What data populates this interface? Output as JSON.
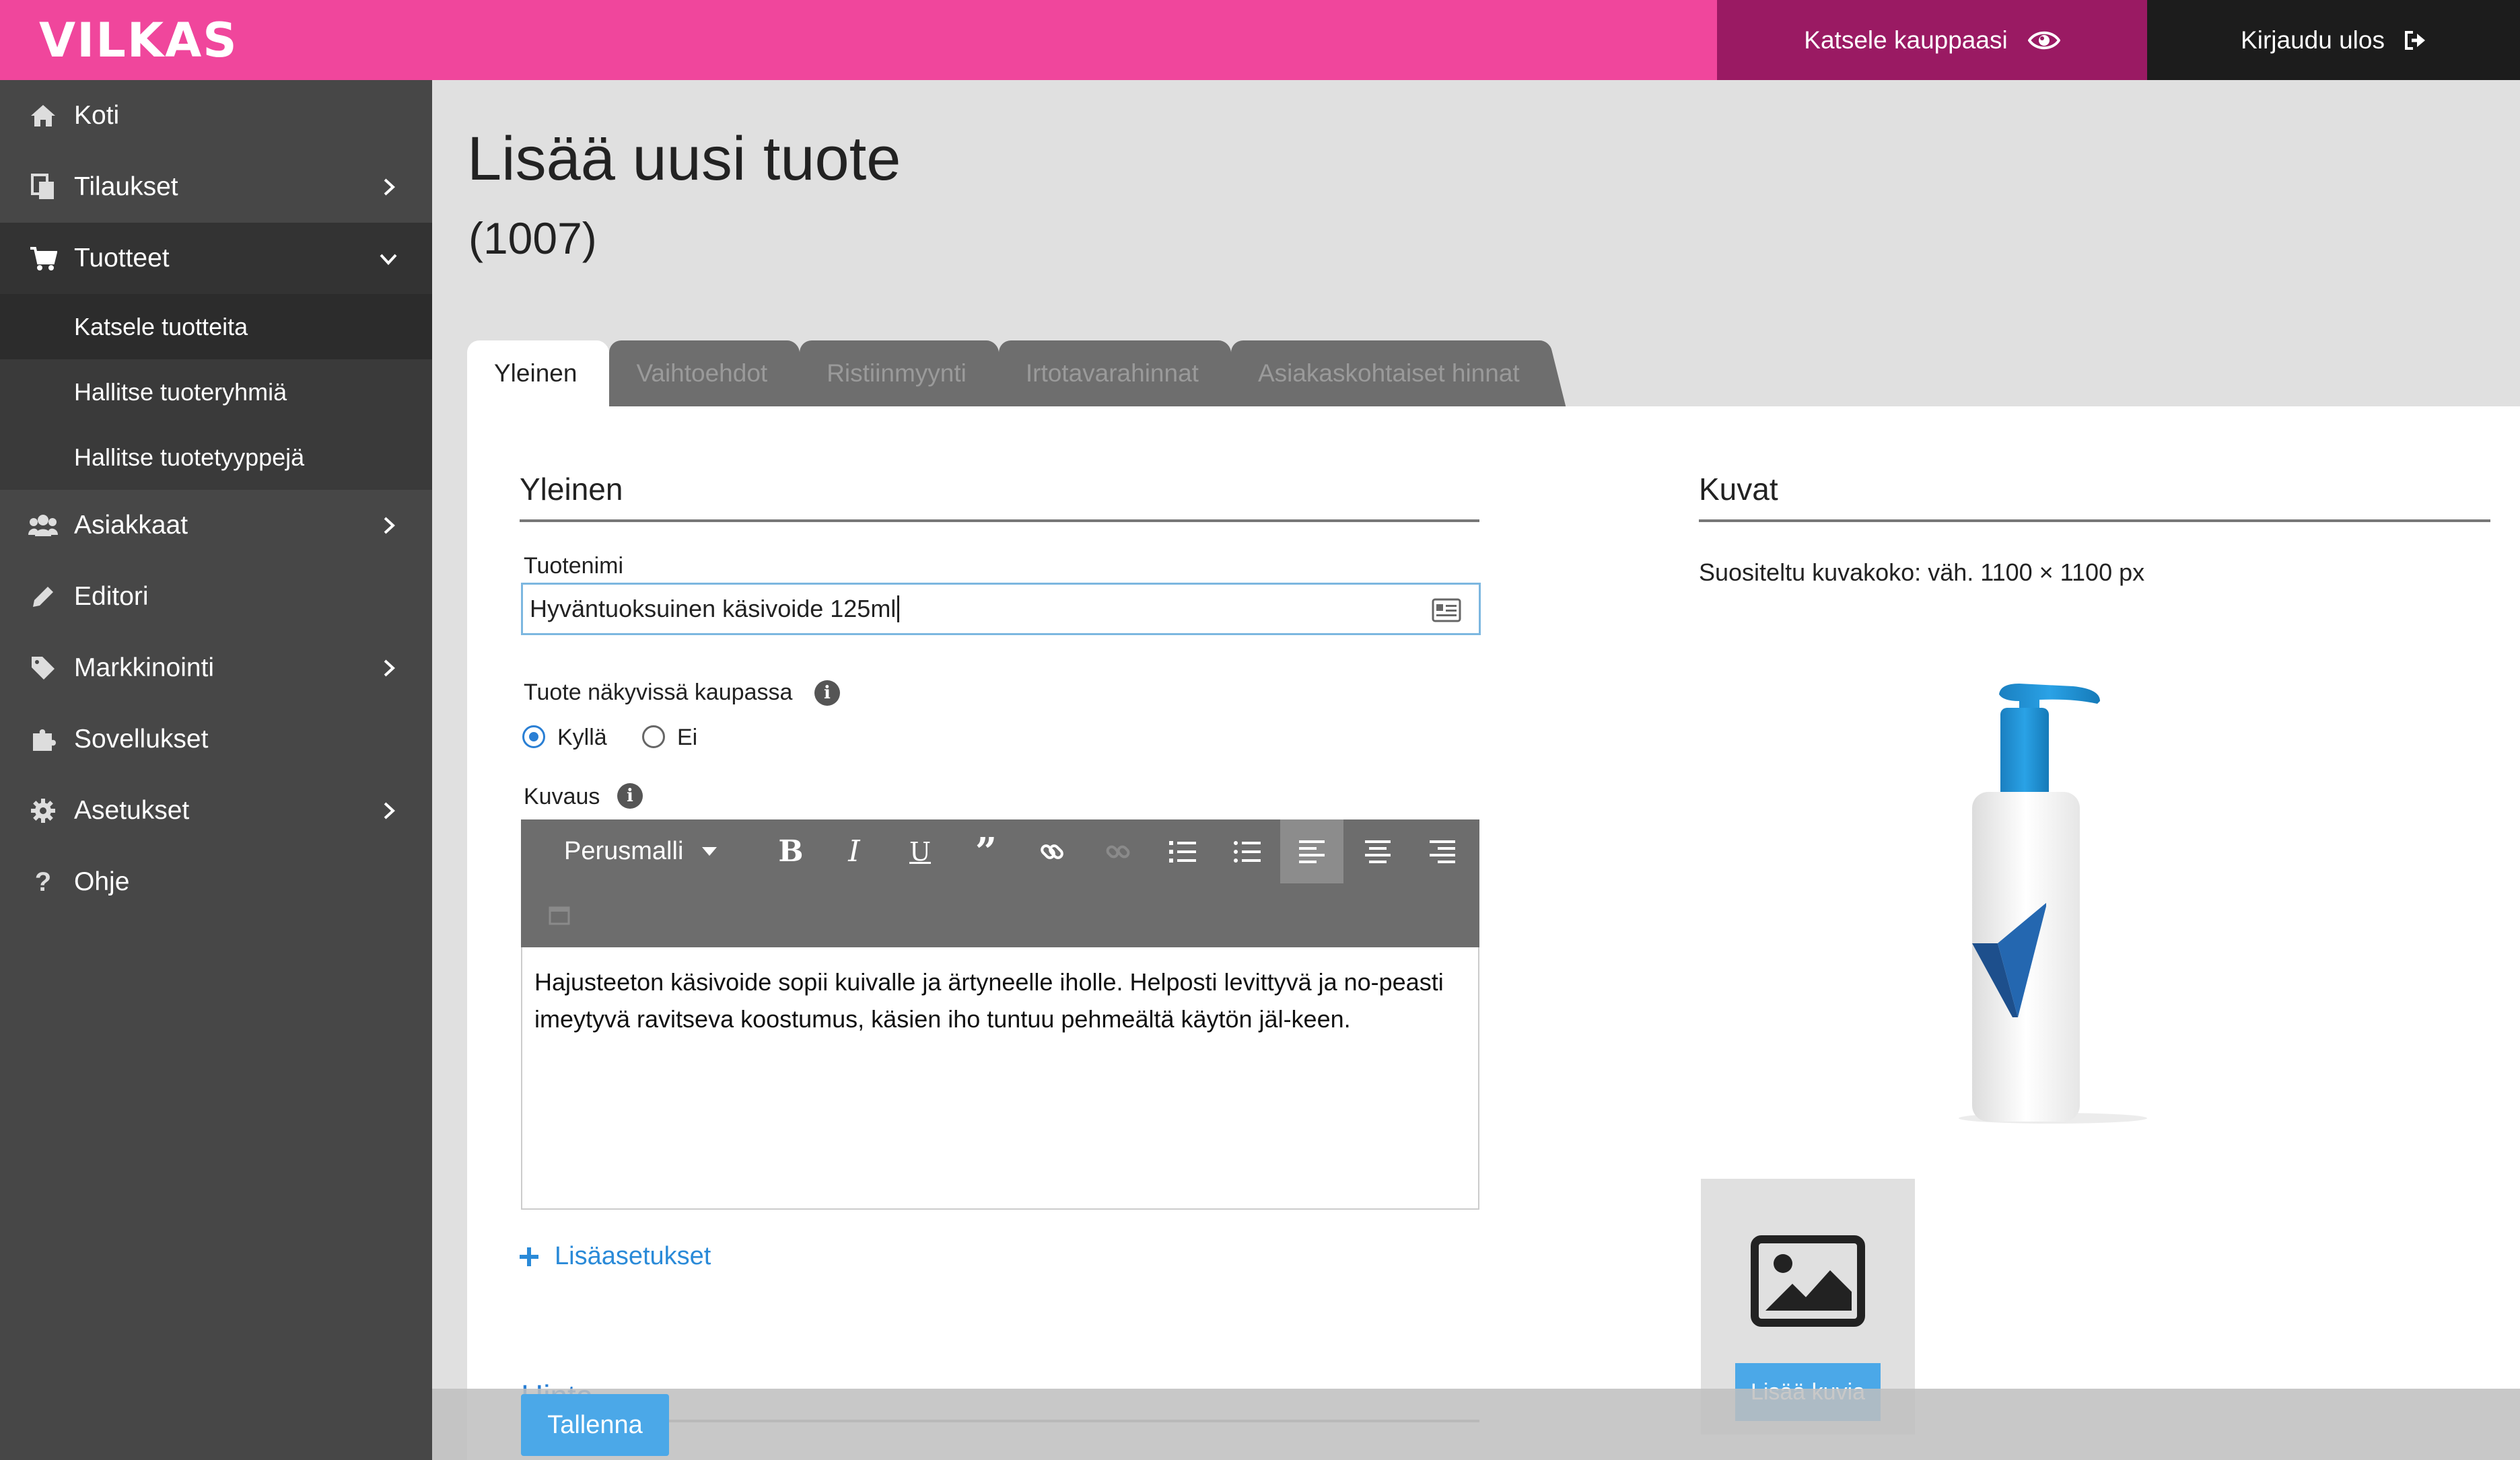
{
  "brand": {
    "logo_text": "VILKAS",
    "colors": {
      "topbar": "#f0469c",
      "view_store": "#9a1a63",
      "logout": "#1c1c1c",
      "accent": "#4ba8e8"
    }
  },
  "header": {
    "view_store_label": "Katsele kauppaasi",
    "logout_label": "Kirjaudu ulos"
  },
  "sidebar": {
    "items": [
      {
        "label": "Koti",
        "icon": "home-icon"
      },
      {
        "label": "Tilaukset",
        "icon": "orders-icon"
      },
      {
        "label": "Tuotteet",
        "icon": "cart-icon"
      },
      {
        "label": "Asiakkaat",
        "icon": "users-icon"
      },
      {
        "label": "Editori",
        "icon": "pencil-icon"
      },
      {
        "label": "Markkinointi",
        "icon": "tag-icon"
      },
      {
        "label": "Sovellukset",
        "icon": "puzzle-icon"
      },
      {
        "label": "Asetukset",
        "icon": "gear-icon"
      },
      {
        "label": "Ohje",
        "icon": "question-icon"
      }
    ],
    "sub_items": [
      "Katsele tuotteita",
      "Hallitse tuoteryhmiä",
      "Hallitse tuotetyyppejä"
    ]
  },
  "page": {
    "title": "Lisää uusi tuote",
    "subtitle": "(1007)"
  },
  "tabs": [
    "Yleinen",
    "Vaihtoehdot",
    "Ristiinmyynti",
    "Irtotavarahinnat",
    "Asiakaskohtaiset hinnat"
  ],
  "general": {
    "heading": "Yleinen",
    "name_label": "Tuotenimi",
    "name_value": "Hyväntuoksuinen käsivoide 125ml",
    "visible_label": "Tuote näkyvissä kaupassa",
    "visible_yes": "Kyllä",
    "visible_no": "Ei",
    "visible_selected": "Kyllä",
    "description_label": "Kuvaus",
    "format_select": "Perusmalli",
    "description": "Hajusteeton käsivoide sopii kuivalle ja ärtyneelle iholle. Helposti levittyvä ja no-peasti imeytyvä ravitseva koostumus, käsien iho tuntuu pehmeältä käytön jäl-keen.",
    "more_settings": "Lisäasetukset",
    "price_heading": "Hinta"
  },
  "images": {
    "heading": "Kuvat",
    "hint": "Suositeltu kuvakoko: väh. 1100 × 1100 px",
    "add_button": "Lisää kuvia"
  },
  "footer": {
    "save_label": "Tallenna"
  }
}
